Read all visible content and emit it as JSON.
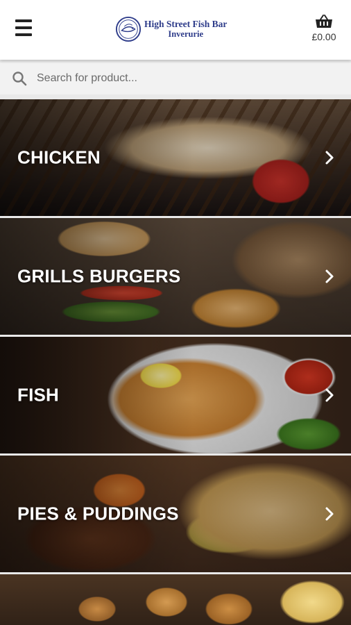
{
  "header": {
    "menu_icon": "hamburger-menu-icon",
    "logo": {
      "line1": "High Street Fish Bar",
      "line2": "Inverurie",
      "color": "#2e3c8a"
    },
    "cart": {
      "icon": "shopping-basket-icon",
      "total": "£0.00"
    }
  },
  "search": {
    "icon": "search-icon",
    "placeholder": "Search for product..."
  },
  "categories": [
    {
      "label": "CHICKEN",
      "icon": "chevron-right-icon"
    },
    {
      "label": "GRILLS BURGERS",
      "icon": "chevron-right-icon"
    },
    {
      "label": "FISH",
      "icon": "chevron-right-icon"
    },
    {
      "label": "PIES & PUDDINGS",
      "icon": "chevron-right-icon"
    },
    {
      "label": "",
      "icon": ""
    }
  ]
}
